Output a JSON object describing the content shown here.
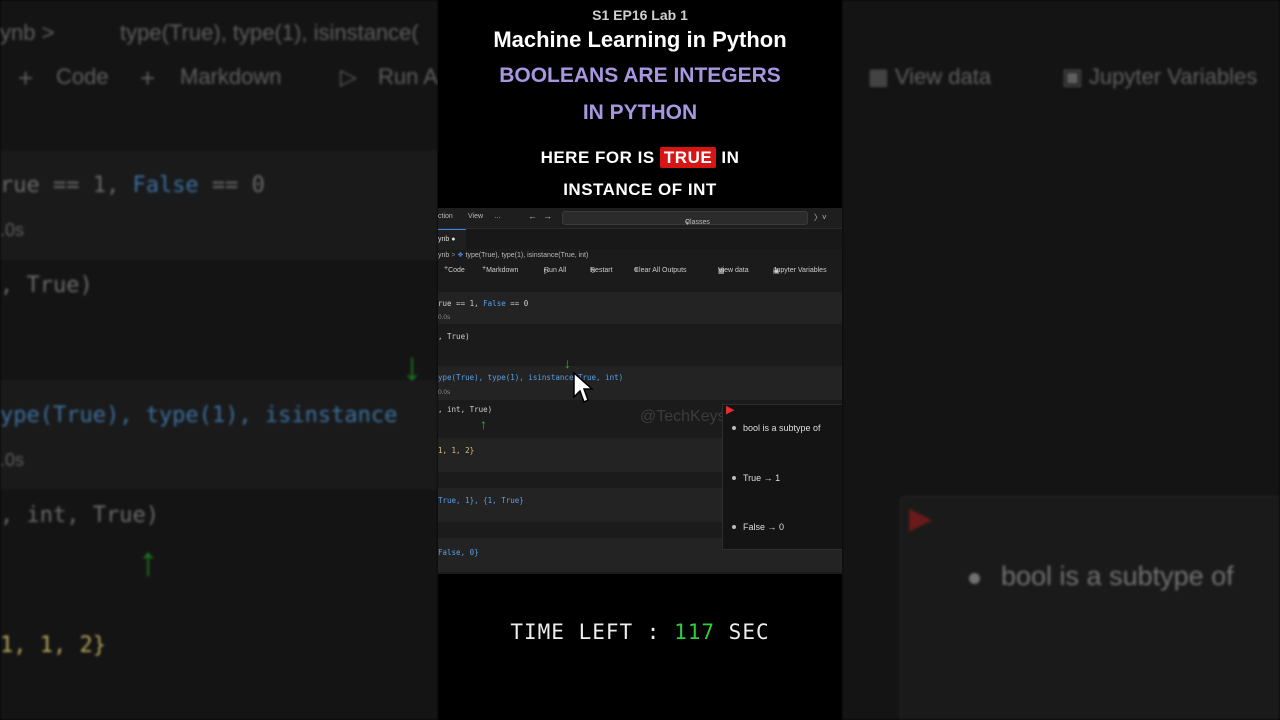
{
  "overlay": {
    "episode": "S1 EP16 Lab 1",
    "course": "Machine Learning in Python",
    "headline_1": "BOOLEANS ARE INTEGERS",
    "headline_2": "IN PYTHON",
    "caption_pre": "HERE FOR IS ",
    "caption_highlight": "TRUE",
    "caption_post": " IN",
    "caption_line2": "INSTANCE OF INT",
    "timer_label": "TIME LEFT : ",
    "timer_value": "117",
    "timer_unit": " SEC",
    "watermark": "@TechKeysX"
  },
  "editor": {
    "menu": [
      "ction",
      "View",
      "…"
    ],
    "search_placeholder": "Classes",
    "tab_label": "ynb",
    "breadcrumb_file": "ynb",
    "breadcrumb_cell": "type(True), type(1), isinstance(True, int)",
    "toolbar": {
      "code": "Code",
      "markdown": "Markdown",
      "run_all": "Run All",
      "restart": "Restart",
      "clear_outputs": "Clear All Outputs",
      "view_data": "View data",
      "jupyter_variables": "Jupyter Variables"
    },
    "cells": {
      "c1_code_a": "rue == 1, ",
      "c1_code_b": "False",
      "c1_code_c": " == 0",
      "c1_time": "0.0s",
      "c1_out": ", True)",
      "c2_code": "ype(True), type(1), isinstance(True, int)",
      "c2_time": "0.0s",
      "c2_out": ", int, True)",
      "c3_out": "1, 1, 2}",
      "c4_out": "True, 1}, {1, True}",
      "c5_out": "False, 0}"
    },
    "tooltip": [
      "bool is a subtype of",
      "True → 1",
      "False → 0"
    ]
  },
  "background": {
    "left_breadcrumb": "ynb  >",
    "left_breadcrumb_cell": "type(True), type(1), isinstance(",
    "left_code_label": "Code",
    "left_markdown_label": "Markdown",
    "left_run_label": "Run A",
    "left_line1_a": "rue == 1, ",
    "left_line1_b": "False",
    "left_line1_c": " == 0",
    "left_time1": ".0s",
    "left_out1": ", True)",
    "left_line2": "ype(True), type(1), isinstance",
    "left_time2": ".0s",
    "left_out2": ", int, True)",
    "left_out3": "1, 1, 2}",
    "right_view_data": "View data",
    "right_jupyter": "Jupyter Variables",
    "right_tip": "bool is a subtype of"
  },
  "colors": {
    "accent_purple": "#a996e0",
    "highlight_red": "#d61515",
    "timer_green": "#2ecc40",
    "keyword_blue": "#5aa0e6"
  }
}
